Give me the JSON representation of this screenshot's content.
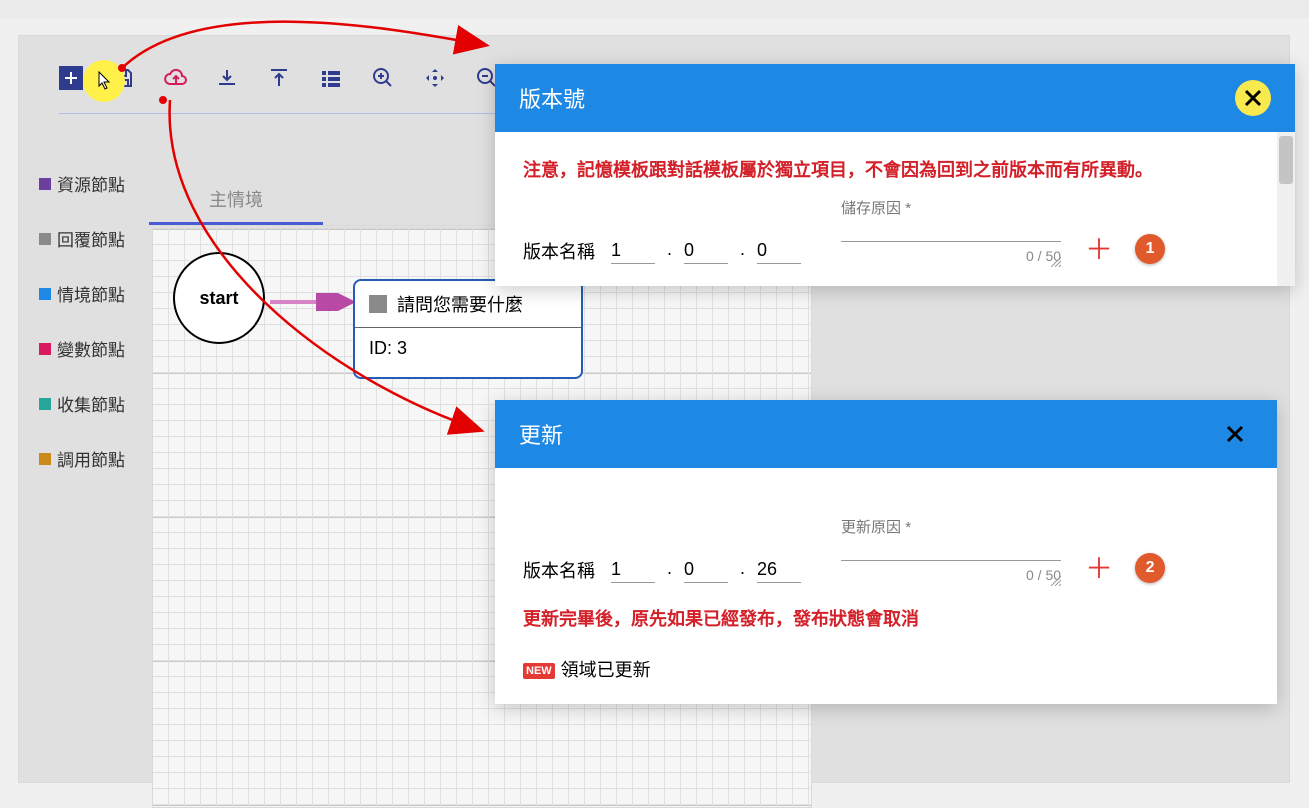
{
  "toolbar": {
    "icons": [
      "add",
      "save",
      "upload",
      "download",
      "upload-arrow",
      "list",
      "zoom-in",
      "pan",
      "zoom-out"
    ]
  },
  "legend": {
    "items": [
      {
        "color": "#6b3fa0",
        "label": "資源節點"
      },
      {
        "color": "#8a8a8a",
        "label": "回覆節點"
      },
      {
        "color": "#1e88e5",
        "label": "情境節點"
      },
      {
        "color": "#d81b60",
        "label": "變數節點"
      },
      {
        "color": "#26a69a",
        "label": "收集節點"
      },
      {
        "color": "#c98a1b",
        "label": "調用節點"
      }
    ]
  },
  "tab_label": "主情境",
  "canvas": {
    "start_label": "start",
    "box_title": "請問您需要什麼",
    "box_id_label": "ID: 3"
  },
  "dialog1": {
    "title": "版本號",
    "warning": "注意，記憶模板跟對話模板屬於獨立項目，不會因為回到之前版本而有所異動。",
    "name_label": "版本名稱",
    "v1": "1",
    "v2": "0",
    "v3": "0",
    "reason_label": "儲存原因 *",
    "counter": "0 / 50",
    "badge": "1"
  },
  "dialog2": {
    "title": "更新",
    "name_label": "版本名稱",
    "v1": "1",
    "v2": "0",
    "v3": "26",
    "reason_label": "更新原因 *",
    "counter": "0 / 50",
    "badge": "2",
    "warning_after": "更新完畢後，原先如果已經發布，發布狀態會取消",
    "new_badge": "NEW",
    "new_text": "領域已更新"
  }
}
